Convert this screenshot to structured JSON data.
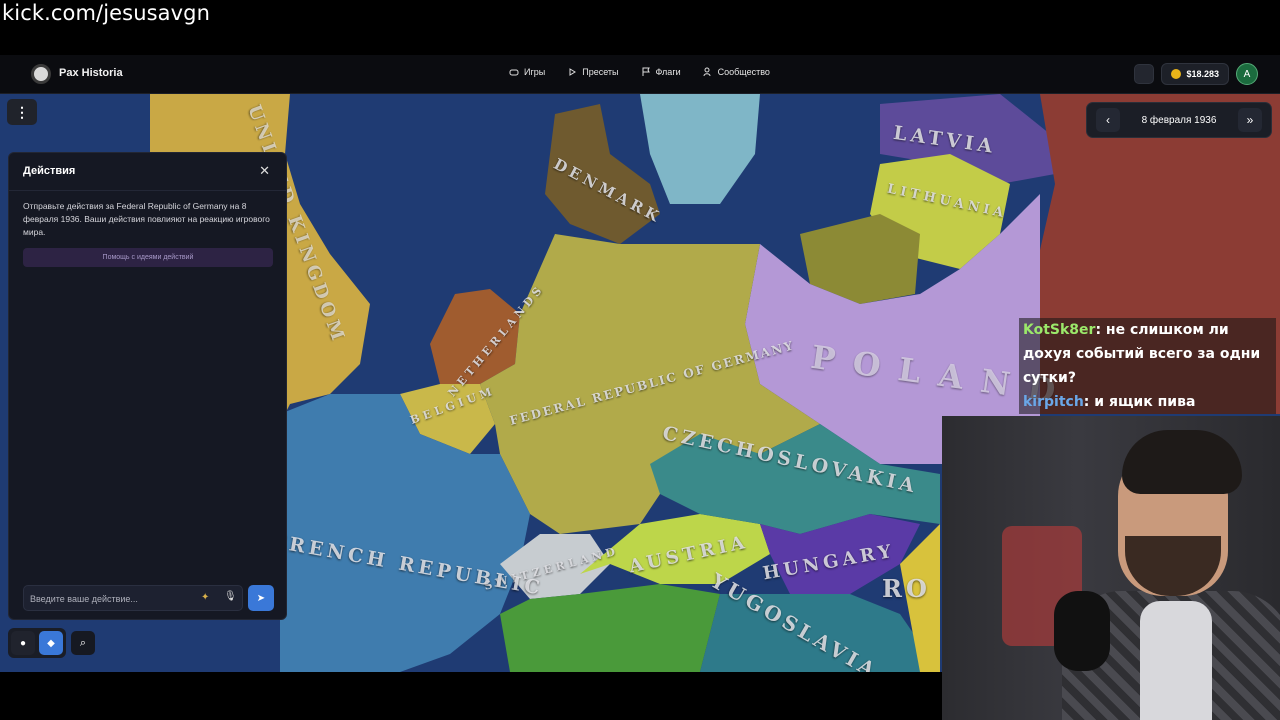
{
  "stream": {
    "url": "kick.com/jesusavgn"
  },
  "app": {
    "brand": "Pax Historia",
    "nav": [
      {
        "label": "Игры",
        "icon": "gamepad-icon"
      },
      {
        "label": "Пресеты",
        "icon": "play-icon"
      },
      {
        "label": "Флаги",
        "icon": "flag-icon"
      },
      {
        "label": "Сообщество",
        "icon": "people-icon"
      }
    ],
    "balance": "$18.283",
    "avatar_letter": "A"
  },
  "date_control": {
    "date": "8 февраля 1936"
  },
  "map": {
    "labels": [
      "DENMARK",
      "LATVIA",
      "LITHUANIA",
      "NETHERLANDS",
      "BELGIUM",
      "FEDERAL REPUBLIC OF GERMANY",
      "POLAND",
      "CZECHOSLOVAKIA",
      "AUSTRIA",
      "HUNGARY",
      "SWITZERLAND",
      "FRENCH REPUBLIC",
      "YUGOSLAVIA",
      "RO",
      "UNITED KINGDOM"
    ]
  },
  "actions_panel": {
    "title": "Действия",
    "description": "Отправьте действия за Federal Republic of Germany на 8 февраля 1936. Ваши действия повлияют на реакцию игрового мира.",
    "help_button": "Помощь с идеями действий",
    "input_placeholder": "Введите ваше действие..."
  },
  "chat": [
    {
      "user": "KotSk8er",
      "message": ": не слишком ли дохуя событий всего за одни сутки?"
    },
    {
      "user": "kirpitch",
      "message": ": и ящик пива"
    }
  ]
}
